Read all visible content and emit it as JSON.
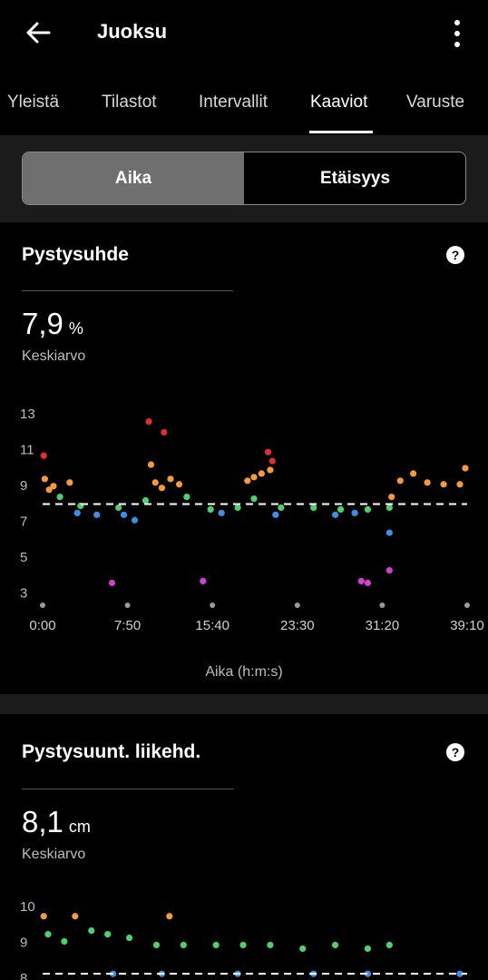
{
  "header": {
    "title": "Juoksu",
    "back_icon": "arrow-left-icon",
    "menu_icon": "more-vertical-icon"
  },
  "tabs": [
    {
      "label": "Yleistä"
    },
    {
      "label": "Tilastot"
    },
    {
      "label": "Intervallit"
    },
    {
      "label": "Kaaviot",
      "active": true
    },
    {
      "label": "Varuste"
    }
  ],
  "segmented": {
    "left": "Aika",
    "right": "Etäisyys",
    "selected": "Aika"
  },
  "card1": {
    "title": "Pystysuhde",
    "value": "7,9",
    "unit": "%",
    "caption": "Keskiarvo",
    "xaxis_title": "Aika (h:m:s)"
  },
  "card2": {
    "title": "Pystysuunt. liikehd.",
    "value": "8,1",
    "unit": "cm",
    "caption": "Keskiarvo"
  },
  "colors": {
    "purple": "#d33fd3",
    "red": "#e02e2e",
    "orange": "#f49a3d",
    "green": "#4fd06a",
    "blue": "#3d8fe6"
  },
  "chart_data": [
    {
      "type": "scatter",
      "xlabel": "Aika (h:m:s)",
      "x_ticks": [
        "0:00",
        "7:50",
        "15:40",
        "23:30",
        "31:20",
        "39:10"
      ],
      "y_ticks": [
        "13",
        "11",
        "9",
        "7",
        "5",
        "3"
      ],
      "ylim": [
        2,
        14
      ],
      "xlim_minutes": [
        0,
        39.17
      ],
      "average": 7.9,
      "series": [
        {
          "color": "red",
          "points": [
            [
              0.1,
              10.6
            ],
            [
              9.8,
              12.5
            ],
            [
              11.2,
              11.9
            ],
            [
              20.8,
              10.8
            ],
            [
              21.2,
              10.3
            ]
          ]
        },
        {
          "color": "purple",
          "points": [
            [
              6.4,
              3.5
            ],
            [
              14.8,
              3.6
            ],
            [
              29.4,
              3.6
            ],
            [
              30.0,
              3.5
            ],
            [
              32.0,
              4.2
            ]
          ]
        },
        {
          "color": "orange",
          "points": [
            [
              0.2,
              9.3
            ],
            [
              0.6,
              8.7
            ],
            [
              1.0,
              8.9
            ],
            [
              2.5,
              9.1
            ],
            [
              10.0,
              10.1
            ],
            [
              10.4,
              9.1
            ],
            [
              11.0,
              8.8
            ],
            [
              11.8,
              9.3
            ],
            [
              12.6,
              9.0
            ],
            [
              18.9,
              9.2
            ],
            [
              19.5,
              9.4
            ],
            [
              20.2,
              9.6
            ],
            [
              21.0,
              9.8
            ],
            [
              32.2,
              8.3
            ],
            [
              33.0,
              9.2
            ],
            [
              34.2,
              9.6
            ],
            [
              35.5,
              9.1
            ],
            [
              37.0,
              9.0
            ],
            [
              38.5,
              9.0
            ],
            [
              39.0,
              9.9
            ]
          ]
        },
        {
          "color": "green",
          "points": [
            [
              1.6,
              8.3
            ],
            [
              3.5,
              7.8
            ],
            [
              7.0,
              7.7
            ],
            [
              9.5,
              8.1
            ],
            [
              13.3,
              8.3
            ],
            [
              15.5,
              7.6
            ],
            [
              18.0,
              7.7
            ],
            [
              19.5,
              8.2
            ],
            [
              22.0,
              7.7
            ],
            [
              25.0,
              7.7
            ],
            [
              27.5,
              7.6
            ],
            [
              30.0,
              7.6
            ],
            [
              32.0,
              7.7
            ]
          ]
        },
        {
          "color": "blue",
          "points": [
            [
              3.2,
              7.4
            ],
            [
              5.0,
              7.3
            ],
            [
              7.5,
              7.3
            ],
            [
              8.5,
              7.0
            ],
            [
              16.5,
              7.4
            ],
            [
              21.5,
              7.3
            ],
            [
              27.0,
              7.3
            ],
            [
              28.8,
              7.4
            ],
            [
              32.0,
              6.3
            ]
          ]
        }
      ]
    },
    {
      "type": "scatter",
      "y_ticks": [
        "10",
        "9",
        "8"
      ],
      "ylim": [
        7.6,
        10.4
      ],
      "xlim_minutes": [
        0,
        39.17
      ],
      "average": 8.1,
      "series": [
        {
          "color": "orange",
          "points": [
            [
              0.1,
              9.7
            ],
            [
              3.0,
              9.7
            ],
            [
              11.7,
              9.7
            ]
          ]
        },
        {
          "color": "green",
          "points": [
            [
              0.5,
              9.2
            ],
            [
              2.0,
              9.0
            ],
            [
              4.5,
              9.3
            ],
            [
              6.0,
              9.2
            ],
            [
              8.0,
              9.1
            ],
            [
              10.5,
              8.9
            ],
            [
              13.0,
              8.9
            ],
            [
              16.0,
              8.9
            ],
            [
              18.5,
              8.9
            ],
            [
              21.0,
              8.9
            ],
            [
              24.0,
              8.8
            ],
            [
              27.0,
              8.9
            ],
            [
              30.0,
              8.8
            ],
            [
              32.0,
              8.9
            ]
          ]
        },
        {
          "color": "blue",
          "points": [
            [
              6.5,
              8.1
            ],
            [
              11.0,
              8.1
            ],
            [
              18.0,
              8.1
            ],
            [
              25.0,
              8.1
            ],
            [
              30.0,
              8.1
            ],
            [
              38.5,
              8.1
            ]
          ]
        }
      ]
    }
  ]
}
